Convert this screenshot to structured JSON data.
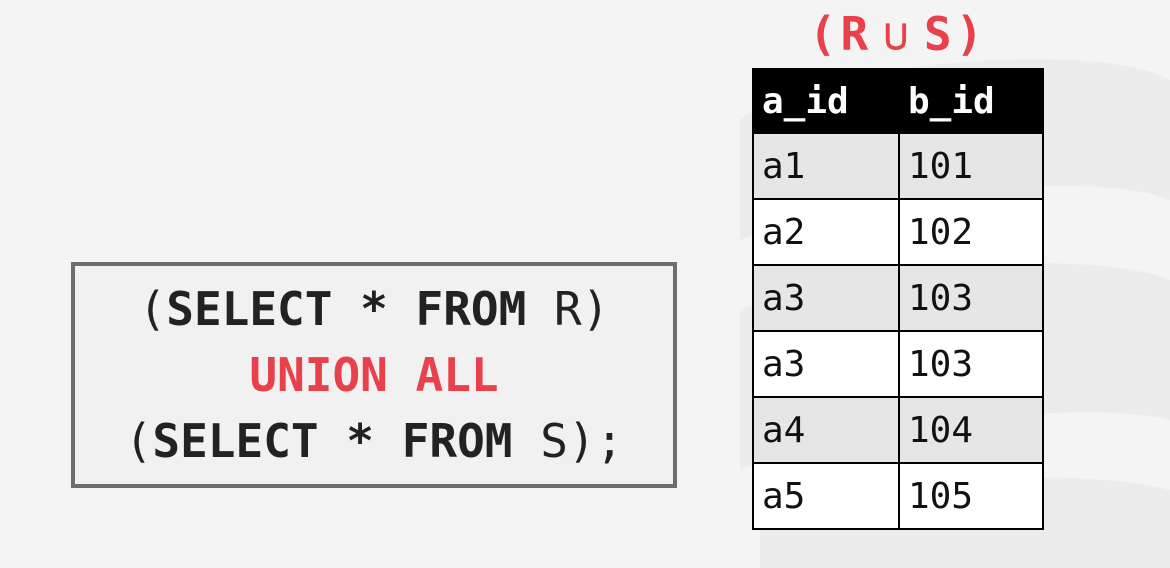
{
  "title": {
    "left": "(R",
    "operator": "∪",
    "right": "S)"
  },
  "table": {
    "headers": [
      "a_id",
      "b_id"
    ],
    "rows": [
      [
        "a1",
        "101"
      ],
      [
        "a2",
        "102"
      ],
      [
        "a3",
        "103"
      ],
      [
        "a3",
        "103"
      ],
      [
        "a4",
        "104"
      ],
      [
        "a5",
        "105"
      ]
    ]
  },
  "sql": {
    "line1": {
      "open": "(",
      "select": "SELECT",
      "star": "*",
      "from": "FROM",
      "rel": "R",
      "close": ")"
    },
    "line2": {
      "op": "UNION ALL"
    },
    "line3": {
      "open": "(",
      "select": "SELECT",
      "star": "*",
      "from": "FROM",
      "rel": "S",
      "close": ");"
    }
  },
  "colors": {
    "accent": "#e8414b",
    "header_bg": "#000000",
    "box_border": "#6e6e6e",
    "background": "#f4f4f4"
  }
}
